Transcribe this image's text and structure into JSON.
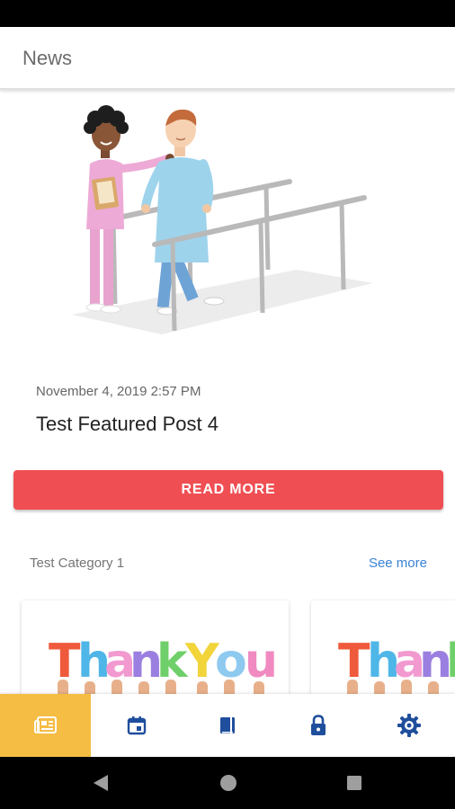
{
  "app_bar": {
    "title": "News"
  },
  "featured_post": {
    "date": "November 4, 2019 2:57 PM",
    "title": "Test Featured Post 4",
    "read_more_label": "READ MORE"
  },
  "category": {
    "title": "Test Category 1",
    "see_more_label": "See more",
    "cards": [
      {
        "image_text": "Thank You"
      },
      {
        "image_text": "Thank You"
      }
    ]
  },
  "bottom_nav": {
    "items": [
      {
        "icon": "news-icon",
        "active": true
      },
      {
        "icon": "calendar-icon",
        "active": false
      },
      {
        "icon": "book-icon",
        "active": false
      },
      {
        "icon": "lock-icon",
        "active": false
      },
      {
        "icon": "settings-icon",
        "active": false
      }
    ]
  },
  "colors": {
    "accent_red": "#ef4f53",
    "active_tab": "#f5bd43",
    "link_blue": "#3b82d6",
    "icon_blue": "#1f4e9c"
  }
}
